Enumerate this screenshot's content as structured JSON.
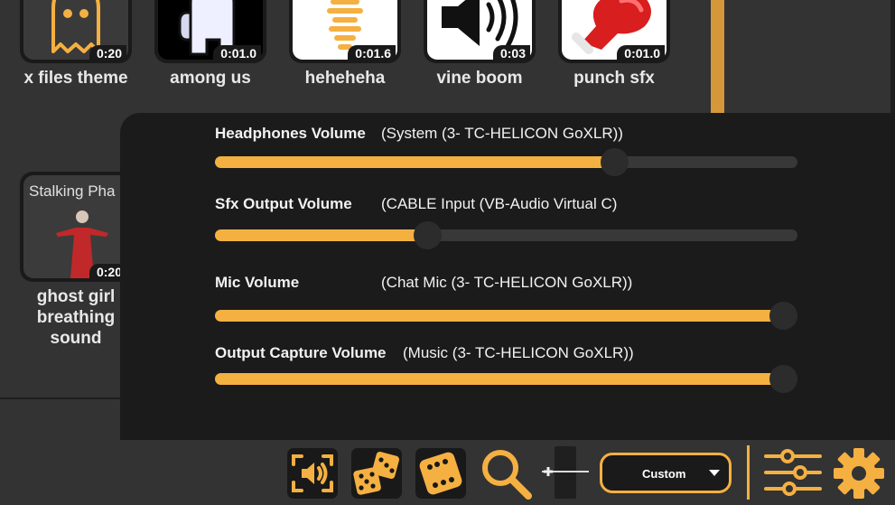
{
  "colors": {
    "accent": "#f5b042",
    "panel": "#1b1b1b",
    "background": "#333333",
    "track": "#383838"
  },
  "sounds": [
    {
      "name": "x files theme",
      "duration": "0:20",
      "icon": "ghost-icon"
    },
    {
      "name": "among us",
      "duration": "0:01.0",
      "icon": "crewmate-icon"
    },
    {
      "name": "heheheha",
      "duration": "0:01.6",
      "icon": "audio-wave-icon"
    },
    {
      "name": "vine boom",
      "duration": "0:03",
      "icon": "speaker-icon"
    },
    {
      "name": "punch sfx",
      "duration": "0:01.0",
      "icon": "boxing-glove-icon"
    },
    {
      "name": "ghost girl breathing sound",
      "duration": "0:20",
      "thumb_text": "Stalking Pha",
      "icon": "ghost-girl-thumbnail"
    }
  ],
  "volumes": [
    {
      "label": "Headphones Volume",
      "device": "(System (3- TC-HELICON GoXLR))",
      "level": 0.685
    },
    {
      "label": "Sfx Output Volume",
      "device": "(CABLE Input (VB-Audio Virtual C)",
      "level": 0.365
    },
    {
      "label": "Mic Volume",
      "device": "(Chat Mic (3- TC-HELICON GoXLR))",
      "level": 0.975
    },
    {
      "label": "Output Capture Volume",
      "device": "(Music (3- TC-HELICON GoXLR))",
      "level": 0.975
    }
  ],
  "toolbar": {
    "preset_value": "Custom",
    "icons": [
      "screen-audio-icon",
      "dice-pair-icon",
      "dice-icon",
      "search-icon",
      "volume-slider-icon",
      "mixer-icon",
      "gear-icon"
    ]
  }
}
